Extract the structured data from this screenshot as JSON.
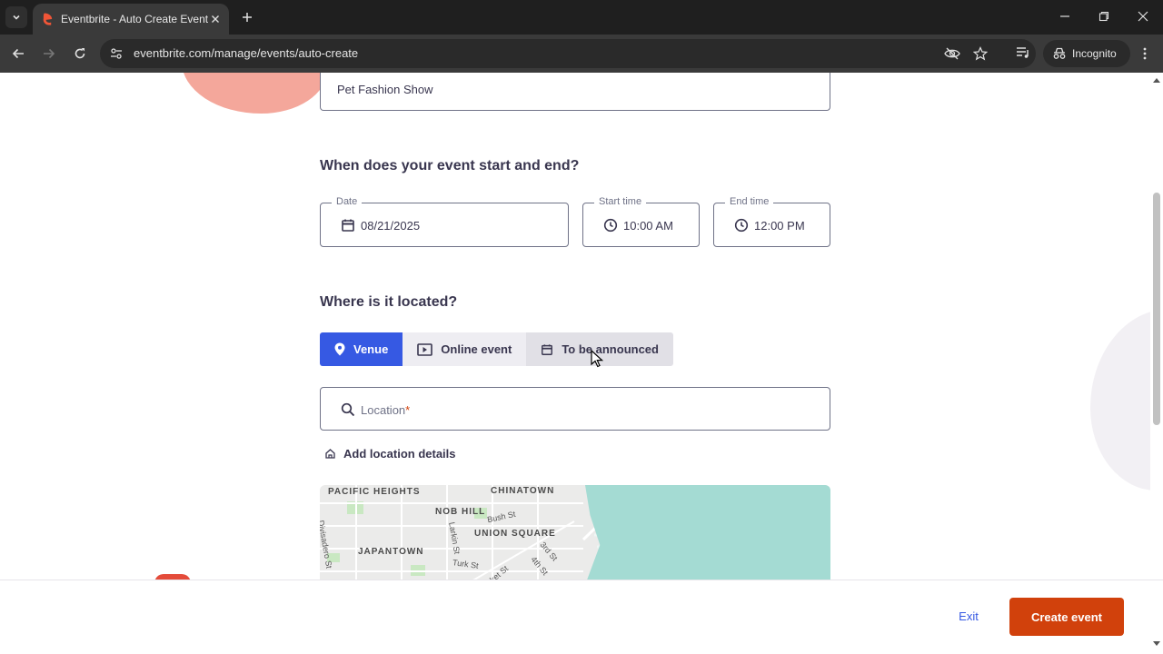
{
  "browser": {
    "tab_title": "Eventbrite - Auto Create Event",
    "url": "eventbrite.com/manage/events/auto-create",
    "incognito_label": "Incognito"
  },
  "form": {
    "event_title_value": "Pet Fashion Show",
    "when_heading": "When does your event start and end?",
    "date": {
      "label": "Date",
      "value": "08/21/2025"
    },
    "start_time": {
      "label": "Start time",
      "value": "10:00 AM"
    },
    "end_time": {
      "label": "End time",
      "value": "12:00 PM"
    },
    "where_heading": "Where is it located?",
    "location_types": [
      {
        "label": "Venue",
        "icon": "pin-icon",
        "selected": true
      },
      {
        "label": "Online event",
        "icon": "video-icon",
        "selected": false
      },
      {
        "label": "To be announced",
        "icon": "calendar-icon",
        "selected": false
      }
    ],
    "location": {
      "placeholder": "Location",
      "required_mark": "*"
    },
    "add_location_details": "Add location details"
  },
  "map": {
    "labels": [
      "PACIFIC HEIGHTS",
      "CHINATOWN",
      "NOB HILL",
      "UNION SQUARE",
      "JAPANTOWN"
    ],
    "streets": [
      "Divisadero St",
      "Bush St",
      "Larkin St",
      "Turk St",
      "Market St",
      "3rd St",
      "4th St"
    ]
  },
  "footer": {
    "exit_label": "Exit",
    "create_label": "Create event"
  },
  "colors": {
    "primary_blue": "#3659e3",
    "brand_orange": "#d1410c",
    "text_dark": "#39364f"
  }
}
